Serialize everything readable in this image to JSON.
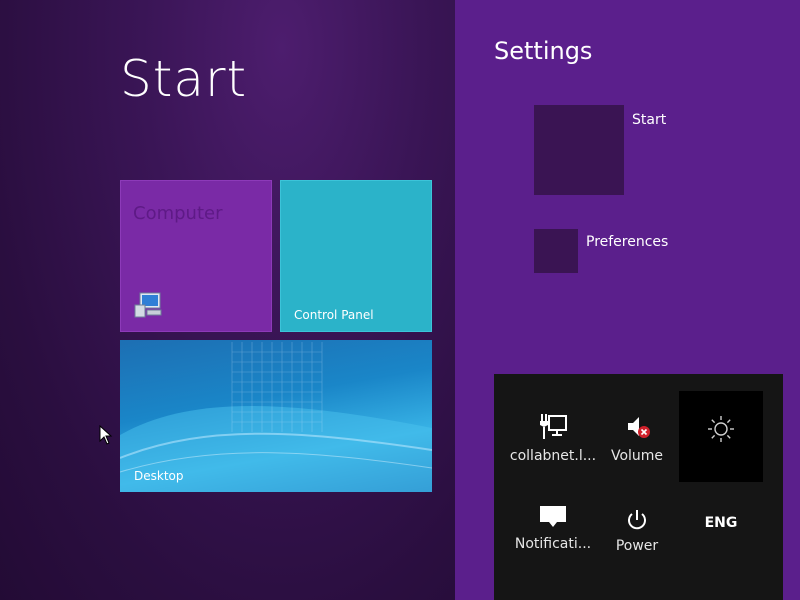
{
  "start": {
    "title": "Start",
    "tiles": {
      "computer": {
        "label": "Computer",
        "color": "#7a2aa6"
      },
      "control_panel": {
        "label": "Control Panel",
        "color": "#2bb3c9"
      },
      "desktop": {
        "label": "Desktop"
      }
    }
  },
  "settings": {
    "title": "Settings",
    "links": [
      {
        "label": "Start"
      },
      {
        "label": "Preferences"
      }
    ],
    "quick": {
      "network_label": "collabnet.l...",
      "volume_label": "Volume",
      "notifications_label": "Notificati...",
      "power_label": "Power",
      "keyboard_label": "ENG"
    }
  },
  "icons": {
    "network": "network-monitor-icon",
    "volume": "volume-muted-icon",
    "brightness": "brightness-icon",
    "notifications": "notifications-icon",
    "power": "power-icon",
    "computer": "computer-icon",
    "cursor": "mouse-cursor-icon"
  }
}
